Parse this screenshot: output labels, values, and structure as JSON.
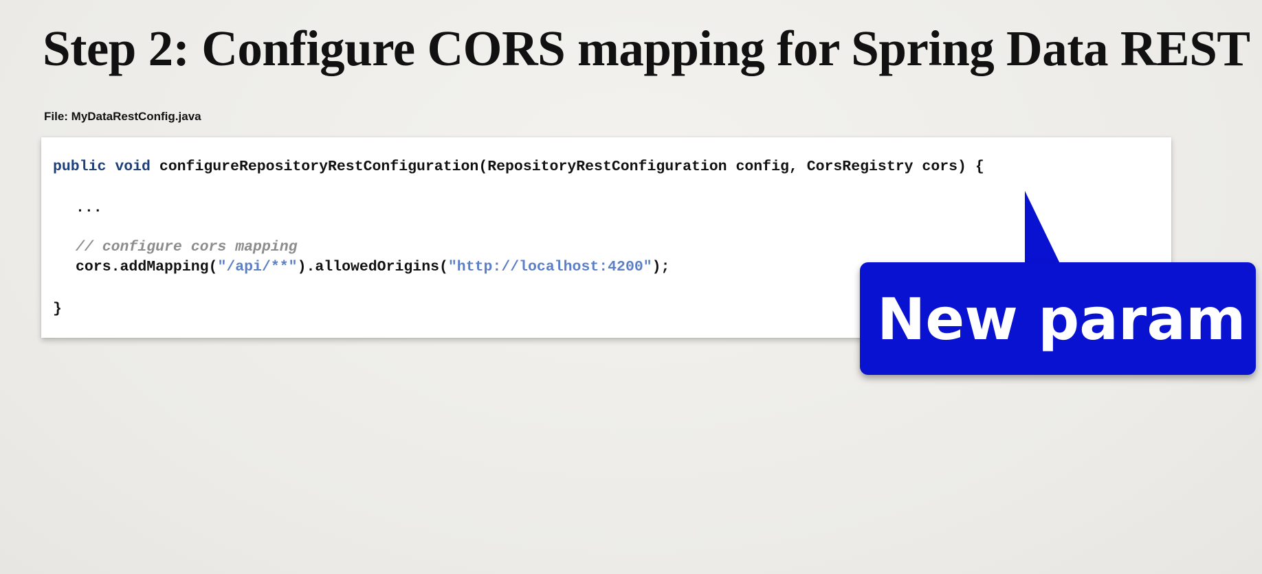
{
  "slide": {
    "title": "Step 2: Configure CORS mapping for Spring Data REST",
    "file_label": "File: MyDataRestConfig.java"
  },
  "code": {
    "line1": {
      "kw_public": "public",
      "kw_void": "void",
      "signature": "configureRepositoryRestConfiguration(RepositoryRestConfiguration config, CorsRegistry cors) {"
    },
    "line2": "...",
    "line3_comment": "// configure cors mapping",
    "line4": {
      "part1": "cors.addMapping(",
      "str1": "\"/api/**\"",
      "part2": ").allowedOrigins(",
      "str2": "\"http://localhost:4200\"",
      "part3": ");"
    },
    "line5": "}"
  },
  "callout": {
    "text": "New param",
    "color": "#0a12d2"
  }
}
